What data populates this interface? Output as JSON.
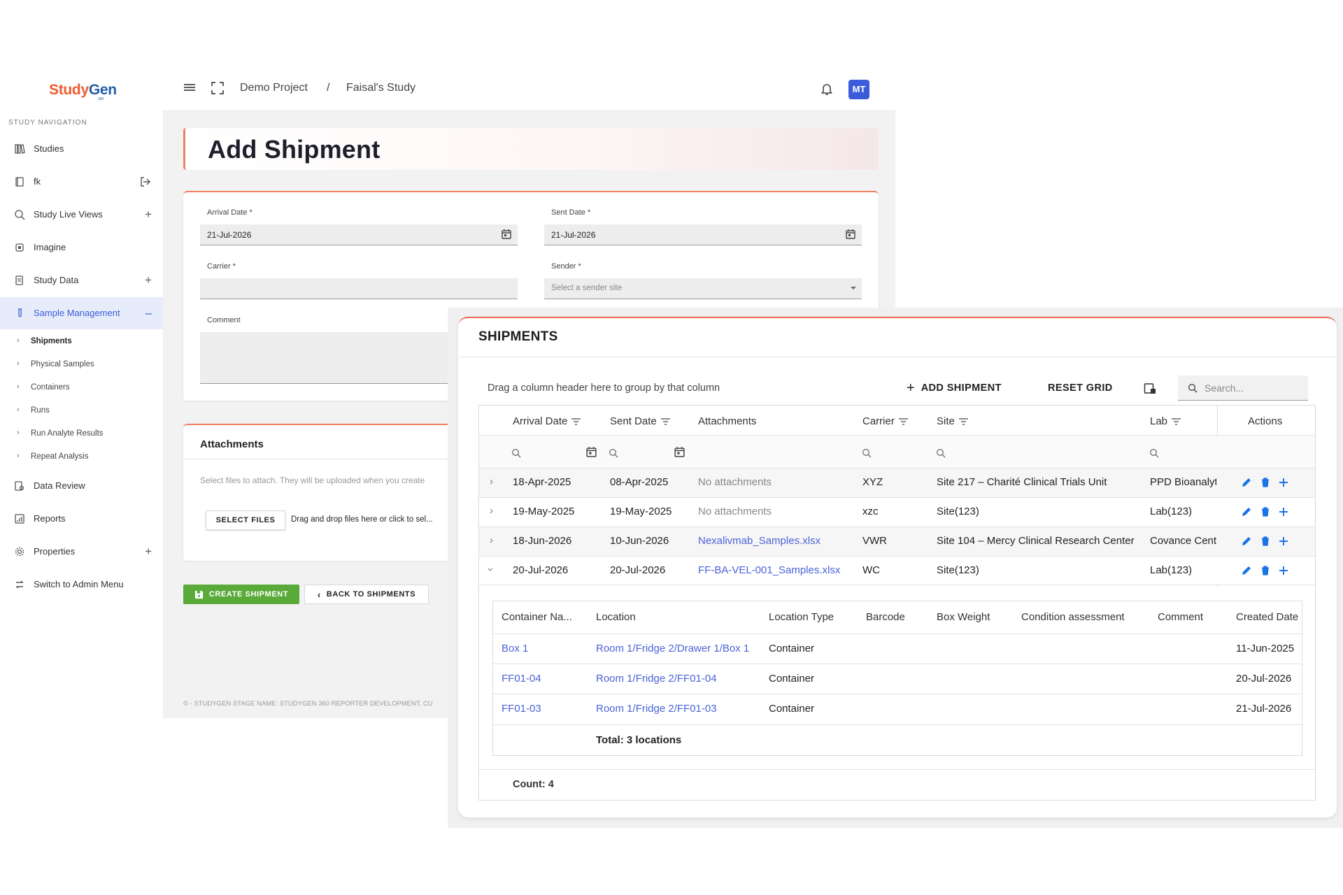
{
  "brand": {
    "name_part1": "Study",
    "name_part2": "Gen",
    "suffix": "360"
  },
  "sidebar": {
    "caption": "STUDY NAVIGATION",
    "items": [
      {
        "label": "Studies"
      },
      {
        "label": "fk"
      },
      {
        "label": "Study Live Views"
      },
      {
        "label": "Imagine"
      },
      {
        "label": "Study Data"
      },
      {
        "label": "Sample Management"
      },
      {
        "label": "Data Review"
      },
      {
        "label": "Reports"
      },
      {
        "label": "Properties"
      },
      {
        "label": "Switch to Admin Menu"
      }
    ],
    "sub_items": [
      {
        "label": "Shipments"
      },
      {
        "label": "Physical Samples"
      },
      {
        "label": "Containers"
      },
      {
        "label": "Runs"
      },
      {
        "label": "Run Analyte Results"
      },
      {
        "label": "Repeat Analysis"
      }
    ]
  },
  "topbar": {
    "breadcrumb": [
      "Demo Project",
      "/",
      "Faisal's Study"
    ],
    "avatar_initials": "MT"
  },
  "page": {
    "title": "Add Shipment"
  },
  "form": {
    "arrival_date_label": "Arrival Date *",
    "arrival_date_value": "21-Jul-2026",
    "sent_date_label": "Sent Date *",
    "sent_date_value": "21-Jul-2026",
    "carrier_label": "Carrier *",
    "carrier_value": "",
    "sender_label": "Sender *",
    "sender_placeholder": "Select a sender site",
    "comment_label": "Comment",
    "comment_value": ""
  },
  "attachments": {
    "title": "Attachments",
    "hint": "Select files to attach. They will be uploaded when you create",
    "select_files_label": "SELECT FILES",
    "drop_text": "Drag and drop files here or click to sel..."
  },
  "actions": {
    "create_label": "CREATE SHIPMENT",
    "back_label": "BACK TO SHIPMENTS"
  },
  "footer": {
    "text": "© - STUDYGEN STAGE NAME: STUDYGEN 360 REPORTER DEVELOPMENT, CU"
  },
  "shipments": {
    "title": "SHIPMENTS",
    "group_hint": "Drag a column header here to group by that column",
    "add_label": "ADD SHIPMENT",
    "reset_label": "RESET GRID",
    "search_placeholder": "Search...",
    "columns": [
      "Arrival Date",
      "Sent Date",
      "Attachments",
      "Carrier",
      "Site",
      "Lab",
      "Actions"
    ],
    "rows": [
      {
        "arrival": "18-Apr-2025",
        "sent": "08-Apr-2025",
        "attachments": "No attachments",
        "carrier": "XYZ",
        "site": "Site 217 – Charité Clinical Trials Unit",
        "lab": "PPD Bioanalyt"
      },
      {
        "arrival": "19-May-2025",
        "sent": "19-May-2025",
        "attachments": "No attachments",
        "carrier": "xzc",
        "site": "Site(123)",
        "lab": "Lab(123)"
      },
      {
        "arrival": "18-Jun-2026",
        "sent": "10-Jun-2026",
        "attachments": "Nexalivmab_Samples.xlsx",
        "carrier": "VWR",
        "site": "Site 104 – Mercy Clinical Research Center",
        "lab": "Covance Centi"
      },
      {
        "arrival": "20-Jul-2026",
        "sent": "20-Jul-2026",
        "attachments": "FF-BA-VEL-001_Samples.xlsx",
        "carrier": "WC",
        "site": "Site(123)",
        "lab": "Lab(123)"
      }
    ],
    "detail": {
      "columns": [
        "Container Na...",
        "Location",
        "Location Type",
        "Barcode",
        "Box Weight",
        "Condition assessment",
        "Comment",
        "Created Date"
      ],
      "rows": [
        {
          "container": "Box 1",
          "location": "Room 1/Fridge 2/Drawer 1/Box 1",
          "type": "Container",
          "created": "11-Jun-2025"
        },
        {
          "container": "FF01-04",
          "location": "Room 1/Fridge 2/FF01-04",
          "type": "Container",
          "created": "20-Jul-2026"
        },
        {
          "container": "FF01-03",
          "location": "Room 1/Fridge 2/FF01-03",
          "type": "Container",
          "created": "21-Jul-2026"
        }
      ],
      "total": "Total: 3 locations"
    },
    "count": "Count: 4"
  },
  "colors": {
    "accent": "#3b5bdb",
    "brand_orange": "#ee5b2f",
    "green": "#5aaa3a",
    "link": "#4a63d6",
    "action_blue": "#1a73e8"
  }
}
